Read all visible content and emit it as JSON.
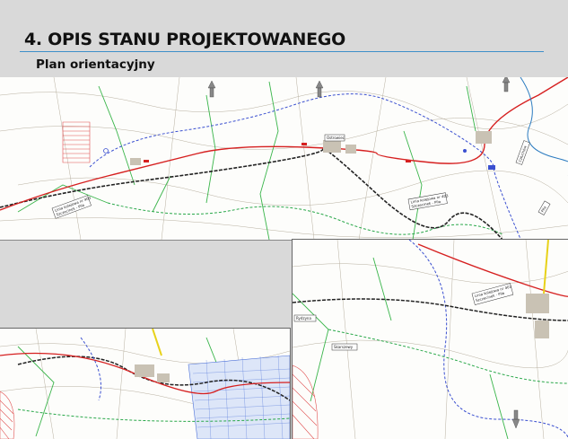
{
  "header": {
    "title": "4. OPIS STANU PROJEKTOWANEGO",
    "subtitle": "Plan orientacyjny"
  },
  "colors": {
    "background": "#d9d9d9",
    "title_rule": "#3d8fc9",
    "road_red": "#d62020",
    "rail_black": "#222222",
    "route_blue": "#3a4fd0",
    "route_green": "#2aa84a",
    "road_yellow": "#e8d21a",
    "river_blue": "#2b7bc0",
    "hatch_red": "#e05050",
    "hatch_blue": "#4a6fd8"
  },
  "maps": {
    "top": {
      "labels": {
        "rail_line_box": "Linia kolejowa nr 403",
        "rail_line_box_2": "Szczecinek - Piła",
        "rail_line_box_b": "Linia kolejowa nr 403",
        "rail_line_box_b2": "Szczecinek - Piła",
        "town_box": "Ostrowiec",
        "pila": "Piła",
        "czluchow": "Człuchów"
      }
    },
    "right": {
      "labels": {
        "rail_line_box": "Linia kolejowa nr 403",
        "rail_line_box_2": "Szczecinek - Piła",
        "town": "Rydzyna",
        "town_2": "Skarszewy"
      }
    }
  }
}
